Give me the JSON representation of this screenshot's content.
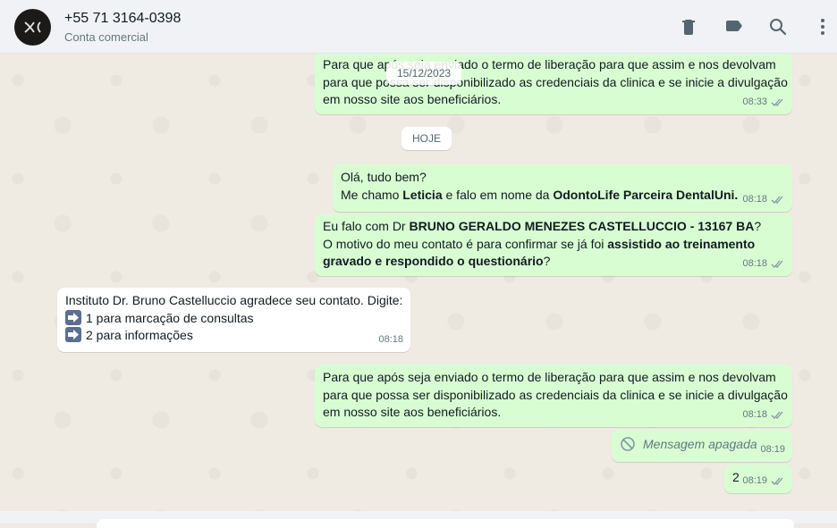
{
  "header": {
    "title": "+55 71 3164-0398",
    "subtitle": "Conta comercial",
    "icons": [
      "delete-icon",
      "label-icon",
      "search-icon",
      "menu-icon"
    ]
  },
  "colors": {
    "outgoing_bubble": "#d9fdd3",
    "incoming_bubble": "#ffffff",
    "chat_background": "#efeae2",
    "header_background": "#f0f2f5",
    "read_ticks": "#53bdeb",
    "sent_ticks": "#8696a0"
  },
  "dates": {
    "floating": "15/12/2023",
    "today": "HOJE"
  },
  "messages": {
    "m1": {
      "lines": [
        "Para  que  após seja enviado o termo de liberação para que assim e nos devolvam",
        "para que possa ser disponibilizado as credenciais da clinica e se inicie a divulgação",
        "em nosso site aos beneficiários."
      ],
      "time": "08:33"
    },
    "m2": {
      "l1": "Olá, tudo bem?",
      "l2_a": "Me chamo ",
      "l2_b": "Leticia",
      "l2_c": " e falo em nome da ",
      "l2_d": "OdontoLife Parceira DentalUni.",
      "time": "08:18"
    },
    "m3": {
      "l1_a": "Eu falo com Dr ",
      "l1_b": "BRUNO GERALDO MENEZES CASTELLUCCIO - 13167 BA",
      "l1_c": "?",
      "l2_a": "O motivo do  meu contato é para confirmar se já foi ",
      "l2_b": "assistido ao  treinamento",
      "l3_a": "gravado e respondido o questionário",
      "l3_b": "?",
      "time": "08:18"
    },
    "m4": {
      "l1": "Instituto Dr. Bruno Castelluccio agradece seu contato. Digite:",
      "l2": "1 para marcação de consultas",
      "l3": "2 para informações",
      "time": "08:18"
    },
    "m5": {
      "lines": [
        "Para  que  após seja enviado o termo de liberação para que assim e nos devolvam",
        "para que possa ser disponibilizado as credenciais da clinica e se inicie a divulgação",
        "em nosso site aos beneficiários."
      ],
      "time": "08:18"
    },
    "m6": {
      "text": "Mensagem apagada",
      "time": "08:19"
    },
    "m7": {
      "text": "2",
      "time": "08:19"
    }
  }
}
